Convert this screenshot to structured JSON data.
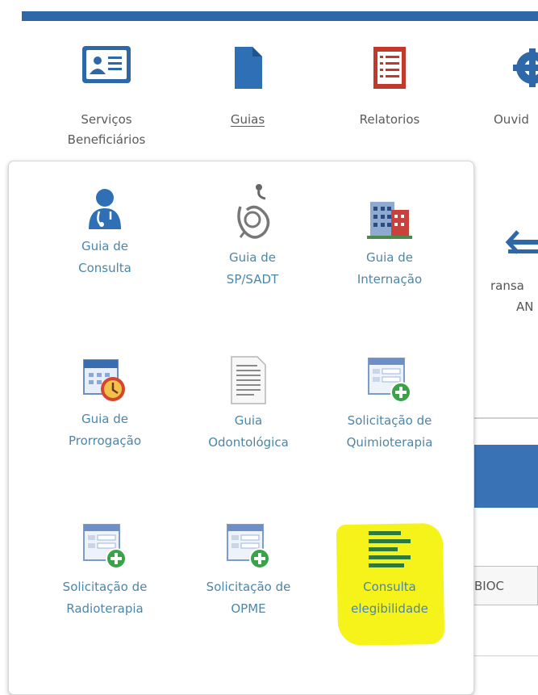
{
  "top_nav": [
    {
      "label_line1": "Serviços",
      "label_line2": "Beneficiários",
      "icon": "id-card-icon"
    },
    {
      "label": "Guias",
      "icon": "document-icon",
      "active": true
    },
    {
      "label": "Relatorios",
      "icon": "report-list-icon"
    },
    {
      "label": "Ouvid",
      "icon": "target-icon"
    }
  ],
  "right_panel": {
    "transa_line1": "ransa",
    "transa_line2": "AN",
    "bioc_text": "BIOC"
  },
  "dropdown": {
    "items": [
      {
        "line1": "Guia de",
        "line2": "Consulta",
        "icon": "doctor-icon"
      },
      {
        "line1": "Guia de",
        "line2": "SP/SADT",
        "icon": "stethoscope-icon"
      },
      {
        "line1": "Guia de",
        "line2": "Internação",
        "icon": "hospital-icon"
      },
      {
        "line1": "Guia de",
        "line2": "Prorrogação",
        "icon": "calendar-clock-icon"
      },
      {
        "line1": "Guia",
        "line2": "Odontológica",
        "icon": "text-document-icon"
      },
      {
        "line1": "Solicitação de",
        "line2": "Quimioterapia",
        "icon": "form-add-icon"
      },
      {
        "line1": "Solicitação de",
        "line2": "Radioterapia",
        "icon": "form-add-icon"
      },
      {
        "line1": "Solicitação de",
        "line2": "OPME",
        "icon": "form-add-icon"
      },
      {
        "line1": "Consulta",
        "line2": "elegibilidade",
        "icon": "list-bars-icon"
      }
    ]
  },
  "colors": {
    "brand_blue": "#2f68a8",
    "link_teal": "#4c86a8",
    "icon_red": "#c0392b",
    "highlight_yellow": "#f6f31b",
    "icon_green": "#3aa34a"
  }
}
